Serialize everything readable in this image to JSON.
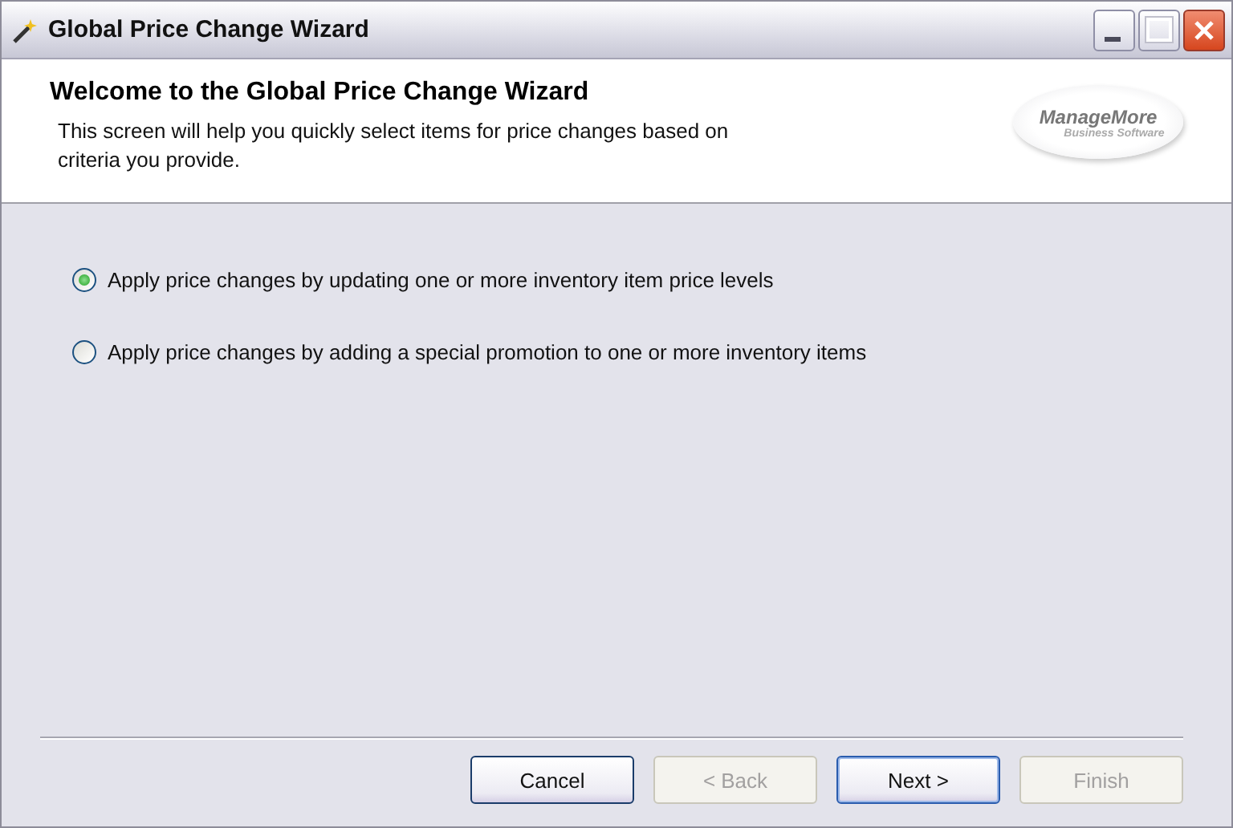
{
  "window": {
    "title": "Global Price Change Wizard"
  },
  "header": {
    "title": "Welcome to the Global Price Change Wizard",
    "description": "This screen will help you quickly select items for price changes based on criteria you provide.",
    "logo": {
      "name": "ManageMore",
      "tagline": "Business Software"
    }
  },
  "options": [
    {
      "label": "Apply price changes by updating one or more inventory item price levels",
      "selected": true
    },
    {
      "label": "Apply price changes by adding a special promotion to one or more inventory items",
      "selected": false
    }
  ],
  "buttons": [
    {
      "label": "Cancel",
      "disabled": false,
      "default": false
    },
    {
      "label": "< Back",
      "disabled": true,
      "default": false
    },
    {
      "label": "Next >",
      "disabled": false,
      "default": true
    },
    {
      "label": "Finish",
      "disabled": true,
      "default": false
    }
  ]
}
